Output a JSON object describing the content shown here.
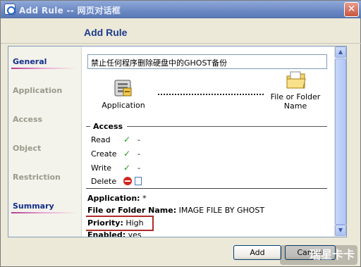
{
  "window": {
    "title": "Add Rule -- 网页对话框",
    "close_label": "✕",
    "heading": "Add Rule"
  },
  "sidebar": {
    "items": [
      {
        "label": "General",
        "active": true
      },
      {
        "label": "Application",
        "active": false
      },
      {
        "label": "Access",
        "active": false
      },
      {
        "label": "Object",
        "active": false
      },
      {
        "label": "Restriction",
        "active": false
      },
      {
        "label": "Summary",
        "active": true
      }
    ]
  },
  "rule": {
    "name": "禁止任何程序删除硬盘中的GHOST备份"
  },
  "diagram": {
    "application_label": "Application",
    "folder_label_line1": "File or Folder",
    "folder_label_line2": "Name"
  },
  "access": {
    "legend": "Access",
    "rows": [
      {
        "label": "Read",
        "mark": "✓",
        "value": "-"
      },
      {
        "label": "Create",
        "mark": "✓",
        "value": "-"
      },
      {
        "label": "Write",
        "mark": "✓",
        "value": "-"
      },
      {
        "label": "Delete",
        "mark": "deny-icon",
        "value": ""
      }
    ]
  },
  "summary": {
    "application_label": "Application:",
    "application_value": "*",
    "folder_label": "File or Folder Name:",
    "folder_value": "IMAGE FILE BY GHOST",
    "priority_label": "Priority:",
    "priority_value": "High",
    "enabled_label": "Enabled:",
    "enabled_value": "yes"
  },
  "buttons": {
    "add": "Add",
    "cancel": "Cancel"
  },
  "watermark": {
    "text": "瑞星卡卡"
  },
  "colors": {
    "heading": "#1C3A8C",
    "nav_active": "#132E8A",
    "nav_inactive": "#9A9A8C",
    "highlight": "#B02A2A",
    "check": "#1E9A1E",
    "deny": "#D5261E"
  }
}
